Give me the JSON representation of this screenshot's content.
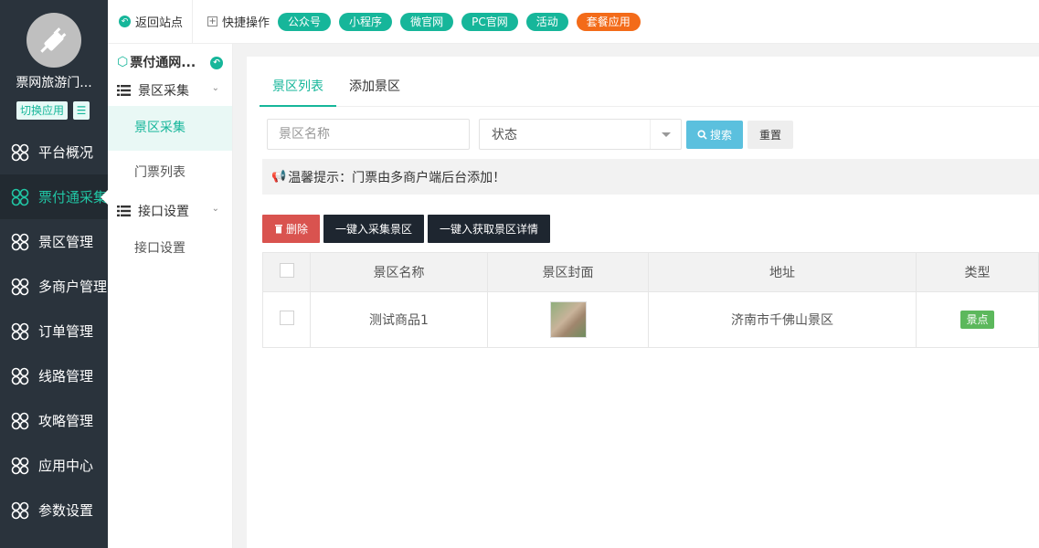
{
  "sidebar": {
    "site_name": "票网旅游门...",
    "switch_label": "切换应用",
    "items": [
      {
        "label": "平台概况",
        "active": false
      },
      {
        "label": "票付通采集",
        "active": true
      },
      {
        "label": "景区管理",
        "active": false
      },
      {
        "label": "多商户管理",
        "active": false
      },
      {
        "label": "订单管理",
        "active": false
      },
      {
        "label": "线路管理",
        "active": false
      },
      {
        "label": "攻略管理",
        "active": false
      },
      {
        "label": "应用中心",
        "active": false
      },
      {
        "label": "参数设置",
        "active": false
      }
    ]
  },
  "topbar": {
    "back_label": "返回站点",
    "quick_label": "快捷操作",
    "tags": [
      {
        "label": "公众号",
        "color": "#16b69a"
      },
      {
        "label": "小程序",
        "color": "#16b69a"
      },
      {
        "label": "微官网",
        "color": "#16b69a"
      },
      {
        "label": "PC官网",
        "color": "#16b69a"
      },
      {
        "label": "活动",
        "color": "#16b69a"
      },
      {
        "label": "套餐应用",
        "color": "#f36b19"
      }
    ]
  },
  "submenu": {
    "title": "票付通网...",
    "groups": [
      {
        "label": "景区采集",
        "items": [
          {
            "label": "景区采集",
            "active": true
          },
          {
            "label": "门票列表",
            "active": false
          }
        ]
      },
      {
        "label": "接口设置",
        "items": [
          {
            "label": "接口设置",
            "active": false
          }
        ]
      }
    ]
  },
  "tabs": [
    {
      "label": "景区列表",
      "active": true
    },
    {
      "label": "添加景区",
      "active": false
    }
  ],
  "filters": {
    "name_placeholder": "景区名称",
    "status_value": "状态",
    "search_label": "搜索",
    "reset_label": "重置"
  },
  "tip": "温馨提示：门票由多商户端后台添加！",
  "actions": {
    "delete_label": "删除",
    "collect_label": "一键入采集景区",
    "fetch_label": "一键入获取景区详情"
  },
  "table": {
    "columns": [
      "景区名称",
      "景区封面",
      "地址",
      "类型"
    ],
    "rows": [
      {
        "name": "测试商品1",
        "address": "济南市千佛山景区",
        "type": "景点"
      }
    ]
  },
  "colors": {
    "accent": "#16b69a",
    "sidebar_bg": "#2a333c",
    "danger": "#d9534f",
    "info": "#5bc0de",
    "success": "#5cb85c"
  }
}
